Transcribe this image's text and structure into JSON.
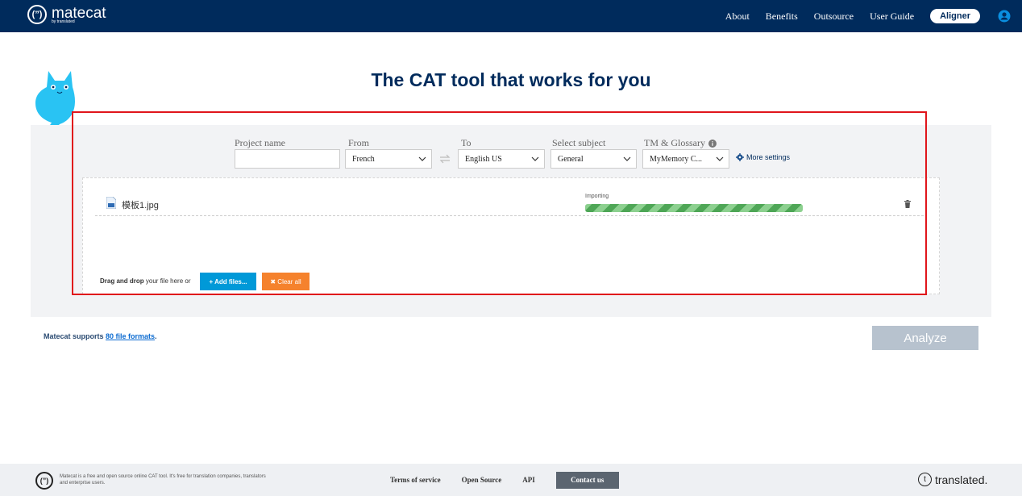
{
  "header": {
    "logo_name": "matecat",
    "logo_sub": "by translated",
    "logo_mark": "(”)",
    "nav": [
      "About",
      "Benefits",
      "Outsource",
      "User Guide"
    ],
    "aligner_label": "Aligner"
  },
  "hero": {
    "title": "The CAT tool that works for you"
  },
  "form": {
    "project_name_label": "Project name",
    "project_name_value": "",
    "from_label": "From",
    "from_value": "French",
    "to_label": "To",
    "to_value": "English US",
    "subject_label": "Select subject",
    "subject_value": "General",
    "tm_label": "TM & Glossary",
    "tm_value": "MyMemory C...",
    "more_settings": "More settings"
  },
  "files": {
    "items": [
      {
        "name": "模板1.jpg",
        "status": "Importing",
        "progress": 1.0
      }
    ],
    "drop_bold": "Drag and drop",
    "drop_rest": "your file here or",
    "add_label": "+ Add files...",
    "clear_label": "✖ Clear all"
  },
  "footer_info": {
    "supports_prefix": "Matecat supports ",
    "supports_link": "80 file formats",
    "supports_suffix": ".",
    "analyze_label": "Analyze"
  },
  "footer": {
    "description": "Matecat is a free and open source online CAT tool. It's free for translation companies, translators and enterprise users.",
    "links": [
      "Terms of service",
      "Open Source",
      "API"
    ],
    "contact_label": "Contact us",
    "brand": "translated."
  },
  "colors": {
    "header_bg": "#002b5c",
    "add_btn": "#0099d8",
    "clear_btn": "#f5822d",
    "progress": "#63b46a",
    "analyze_disabled": "#b7c2ce",
    "highlight": "#e0151b"
  }
}
